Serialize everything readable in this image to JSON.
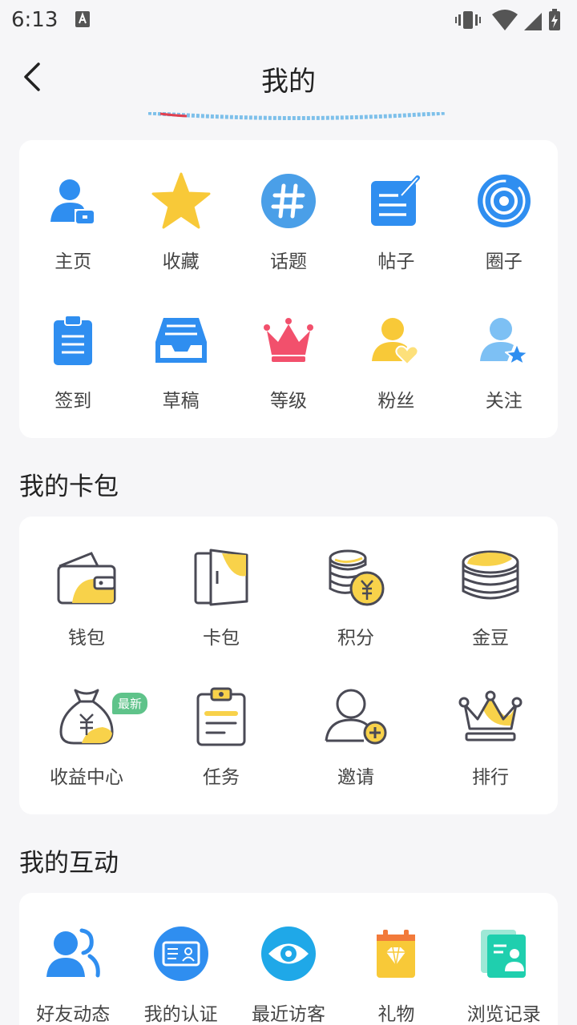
{
  "status": {
    "time": "6:13"
  },
  "header": {
    "title": "我的"
  },
  "top_grid": {
    "items": [
      {
        "label": "主页",
        "icon": "user-home-icon"
      },
      {
        "label": "收藏",
        "icon": "star-icon"
      },
      {
        "label": "话题",
        "icon": "hashtag-icon"
      },
      {
        "label": "帖子",
        "icon": "post-edit-icon"
      },
      {
        "label": "圈子",
        "icon": "circle-target-icon"
      },
      {
        "label": "签到",
        "icon": "clipboard-icon"
      },
      {
        "label": "草稿",
        "icon": "inbox-tray-icon"
      },
      {
        "label": "等级",
        "icon": "crown-icon"
      },
      {
        "label": "粉丝",
        "icon": "fan-heart-icon"
      },
      {
        "label": "关注",
        "icon": "follow-star-icon"
      }
    ]
  },
  "wallet_section": {
    "title": "我的卡包",
    "items": [
      {
        "label": "钱包",
        "icon": "wallet-icon"
      },
      {
        "label": "卡包",
        "icon": "card-pack-icon"
      },
      {
        "label": "积分",
        "icon": "points-coins-icon"
      },
      {
        "label": "金豆",
        "icon": "gold-beans-icon"
      },
      {
        "label": "收益中心",
        "icon": "money-bag-icon",
        "badge": "最新"
      },
      {
        "label": "任务",
        "icon": "task-clipboard-icon"
      },
      {
        "label": "邀请",
        "icon": "invite-user-icon"
      },
      {
        "label": "排行",
        "icon": "ranking-crown-icon"
      }
    ]
  },
  "interaction_section": {
    "title": "我的互动",
    "items": [
      {
        "label": "好友动态",
        "icon": "friends-icon"
      },
      {
        "label": "我的认证",
        "icon": "id-card-icon"
      },
      {
        "label": "最近访客",
        "icon": "eye-icon"
      },
      {
        "label": "礼物",
        "icon": "gift-diamond-icon"
      },
      {
        "label": "浏览记录",
        "icon": "browse-history-icon"
      }
    ]
  },
  "colors": {
    "blue": "#2f8ef0",
    "yellow": "#f8c938",
    "pink": "#f2506c",
    "teal": "#1fcfae",
    "outline": "#4a4a55",
    "badge": "#5fc38a"
  }
}
